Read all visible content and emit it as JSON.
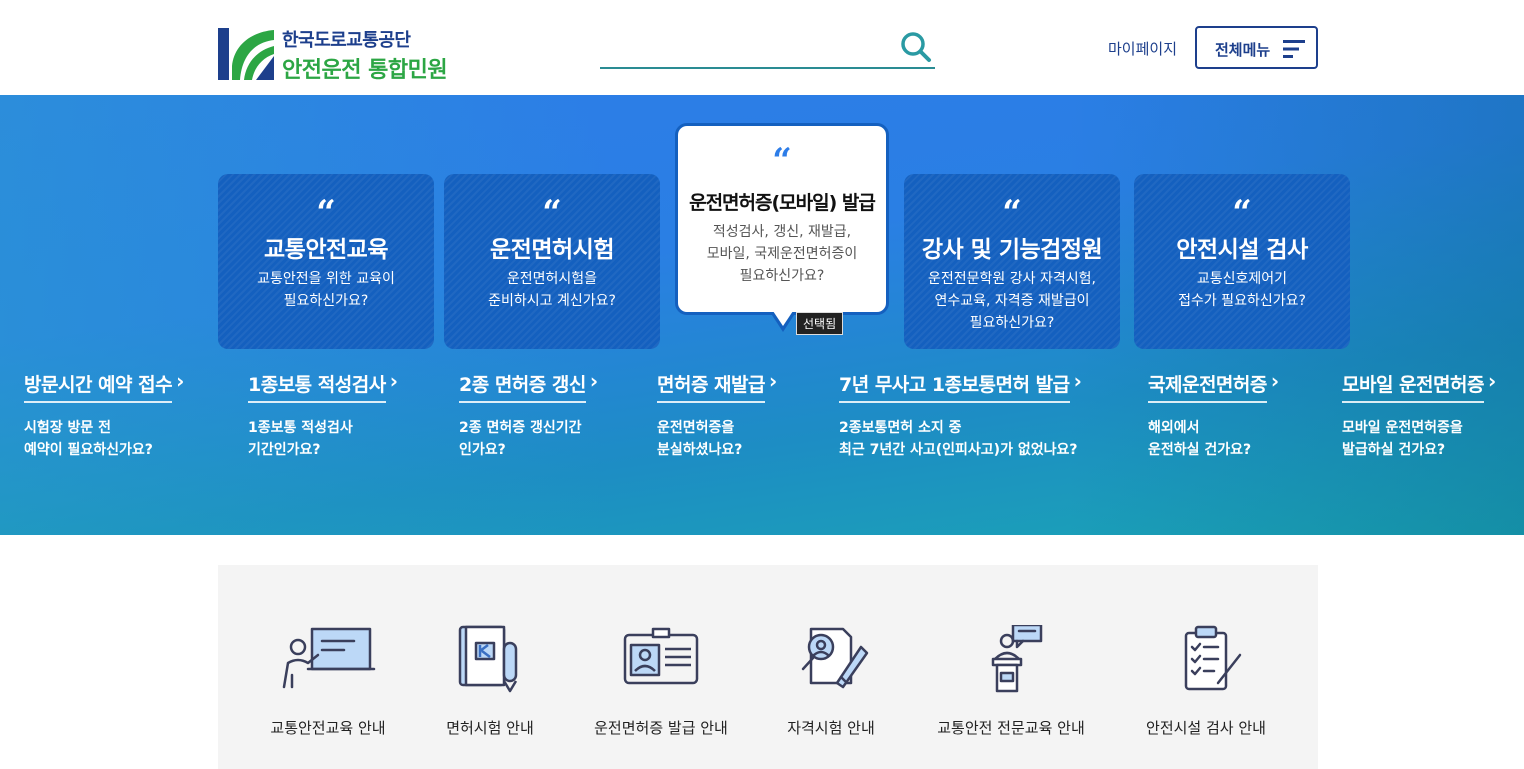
{
  "header": {
    "logo_top": "한국도로교통공단",
    "logo_bottom": "안전운전 통합민원",
    "search_value": "",
    "mypage_label": "마이페이지",
    "allmenu_label": "전체메뉴"
  },
  "cards": [
    {
      "title": "교통안전교육",
      "desc": "교통안전을 위한 교육이\n필요하신가요?"
    },
    {
      "title": "운전면허시험",
      "desc": "운전면허시험을\n준비하시고 계신가요?"
    },
    {
      "title": "운전면허증(모바일) 발급",
      "desc": "적성검사, 갱신, 재발급,\n모바일, 국제운전면허증이\n필요하신가요?"
    },
    {
      "title": "강사 및 기능검정원",
      "desc": "운전전문학원 강사 자격시험,\n연수교육, 자격증 재발급이\n필요하신가요?"
    },
    {
      "title": "안전시설 검사",
      "desc": "교통신호제어기\n접수가 필요하신가요?"
    }
  ],
  "quote_mark": "“",
  "selected_label": "선택됨",
  "arrow": "›",
  "services": [
    {
      "title": "방문시간 예약 접수",
      "desc": "시험장 방문 전\n예약이 필요하신가요?"
    },
    {
      "title": "1종보통 적성검사",
      "desc": "1종보통 적성검사\n기간인가요?"
    },
    {
      "title": "2종 면허증 갱신",
      "desc": "2종 면허증 갱신기간\n인가요?"
    },
    {
      "title": "면허증 재발급",
      "desc": "운전면허증을\n분실하셨나요?"
    },
    {
      "title": "7년 무사고 1종보통면허 발급",
      "desc": "2종보통면허 소지 중\n최근 7년간 사고(인피사고)가 없었나요?"
    },
    {
      "title": "국제운전면허증",
      "desc": "해외에서\n운전하실 건가요?"
    },
    {
      "title": "모바일 운전면허증",
      "desc": "모바일 운전면허증을\n발급하실 건가요?"
    }
  ],
  "guides": [
    {
      "label": "교통안전교육 안내",
      "icon": "lecture-icon"
    },
    {
      "label": "면허시험 안내",
      "icon": "exam-notebook-icon"
    },
    {
      "label": "운전면허증 발급 안내",
      "icon": "id-card-icon"
    },
    {
      "label": "자격시험 안내",
      "icon": "certificate-icon"
    },
    {
      "label": "교통안전 전문교육 안내",
      "icon": "podium-speaker-icon"
    },
    {
      "label": "안전시설 검사 안내",
      "icon": "checklist-icon"
    }
  ],
  "colors": {
    "brand_navy": "#1d3f8c",
    "brand_green": "#2ca644",
    "card_blue": "#1460bf",
    "hero_blue": "#2d7de8",
    "hero_teal": "#1aa6b4",
    "search_teal": "#2a8c93"
  }
}
